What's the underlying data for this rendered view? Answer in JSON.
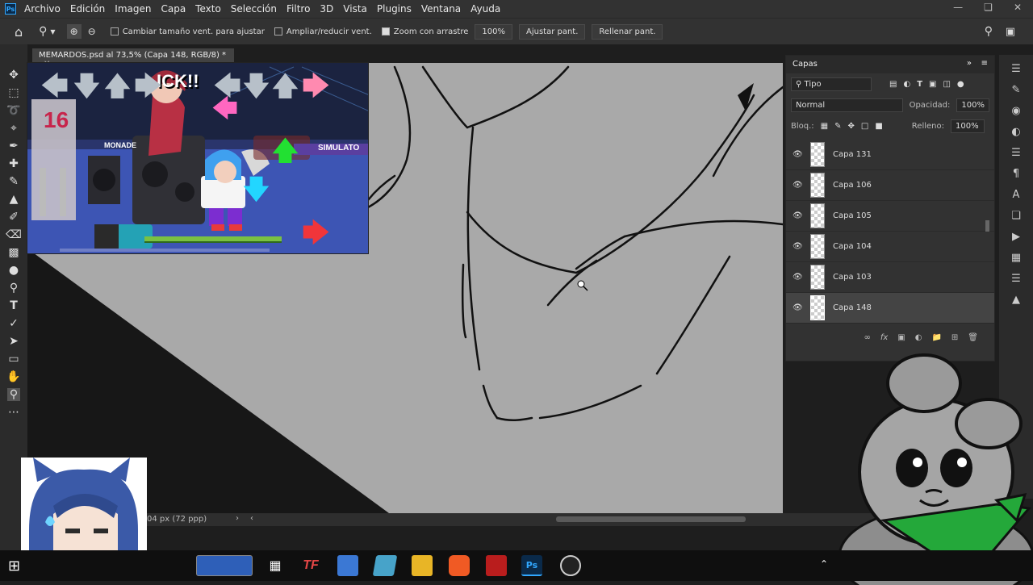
{
  "menubar": {
    "app_icon": "Ps",
    "items": [
      "Archivo",
      "Edición",
      "Imagen",
      "Capa",
      "Texto",
      "Selección",
      "Filtro",
      "3D",
      "Vista",
      "Plugins",
      "Ventana",
      "Ayuda"
    ]
  },
  "options": {
    "resize_windows": "Cambiar tamaño vent. para ajustar",
    "zoom_all": "Ampliar/reducir vent.",
    "scrubby_zoom": "Zoom con arrastre",
    "zoom_value": "100%",
    "fit_screen": "Ajustar pant.",
    "fill_screen": "Rellenar pant."
  },
  "document": {
    "tab_title": "MEMARDOS.psd al 73,5% (Capa 148, RGB/8) *",
    "status": "04 px (72 ppp)"
  },
  "layers": {
    "panel_title": "Capas",
    "filter": "Tipo",
    "blend_mode": "Normal",
    "opacity_label": "Opacidad:",
    "opacity_value": "100%",
    "lock_label": "Bloq.:",
    "fill_label": "Relleno:",
    "fill_value": "100%",
    "items": [
      {
        "name": "Capa 131"
      },
      {
        "name": "Capa 106"
      },
      {
        "name": "Capa 105"
      },
      {
        "name": "Capa 104"
      },
      {
        "name": "Capa 103"
      },
      {
        "name": "Capa 148"
      }
    ]
  },
  "overlay_game": {
    "score_text": "16",
    "sign_left": "MONADE",
    "sign_right": "SIMULATO",
    "shout": "ICK!!"
  },
  "colors": {
    "photoshop_blue": "#31a8ff",
    "arrow_green": "#22e032",
    "arrow_cyan": "#22d6ff",
    "arrow_red": "#f0353a",
    "arrow_pink": "#ff67c0",
    "bandana_green": "#24a83a"
  }
}
